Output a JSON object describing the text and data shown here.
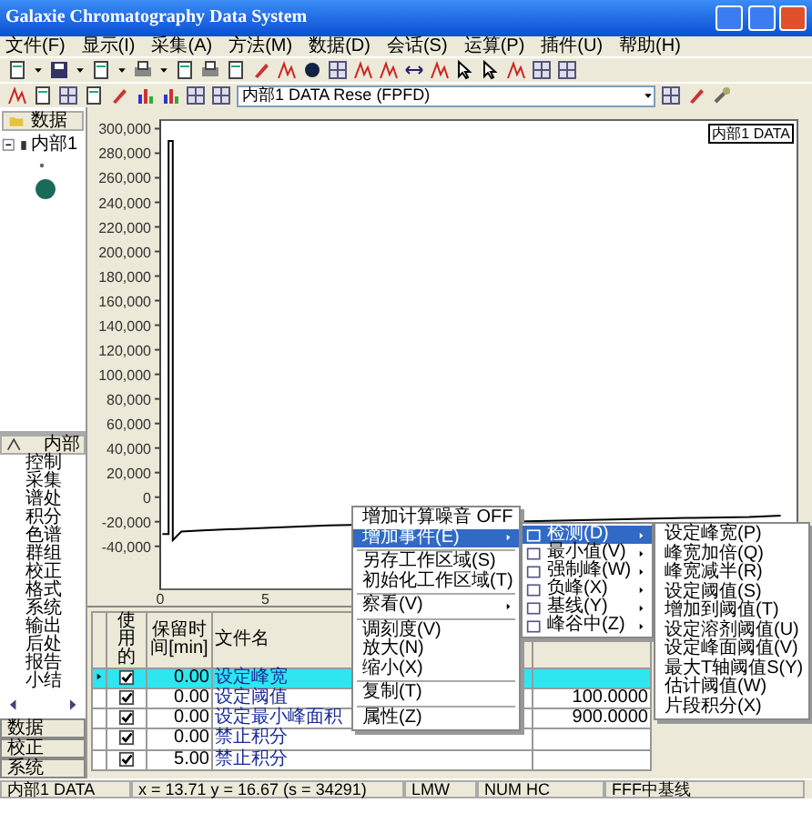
{
  "window": {
    "title": "Galaxie Chromatography Data System"
  },
  "menu_bar": [
    "文件(F)",
    "显示(I)",
    "采集(A)",
    "方法(M)",
    "数据(D)",
    "会话(S)",
    "运算(P)",
    "插件(U)",
    "帮助(H)"
  ],
  "toolbar": {
    "channel_select": "内部1 DATA Rese (FPFD)"
  },
  "tree_panel": {
    "header": "数据",
    "items": [
      {
        "label": "内部1",
        "expanded": true
      }
    ]
  },
  "method_panel": {
    "header": "内部",
    "items": [
      "控制",
      "采集",
      "谱处",
      "积分",
      "色谱",
      "群组",
      "校正",
      "格式",
      "系统",
      "输出",
      "后处",
      "报告",
      "小结"
    ]
  },
  "panel_buttons": [
    "数据",
    "校正",
    "系统"
  ],
  "chart": {
    "tag": "内部1 DATA",
    "chart_data": {
      "type": "line",
      "xlim": [
        0,
        30.3
      ],
      "ylim": [
        -75000,
        307000
      ],
      "xticks": [
        0,
        5
      ],
      "yticks": [
        {
          "value": 300000,
          "label": "300,000"
        },
        {
          "value": 280000,
          "label": "280,000"
        },
        {
          "value": 260000,
          "label": "260,000"
        },
        {
          "value": 240000,
          "label": "240,000"
        },
        {
          "value": 220000,
          "label": "220,000"
        },
        {
          "value": 200000,
          "label": "200,000"
        },
        {
          "value": 180000,
          "label": "180,000"
        },
        {
          "value": 160000,
          "label": "160,000"
        },
        {
          "value": 140000,
          "label": "140,000"
        },
        {
          "value": 120000,
          "label": "120,000"
        },
        {
          "value": 100000,
          "label": "100,000"
        },
        {
          "value": 80000,
          "label": "80,000"
        },
        {
          "value": 60000,
          "label": "60,000"
        },
        {
          "value": 40000,
          "label": "40,000"
        },
        {
          "value": 20000,
          "label": "20,000"
        },
        {
          "value": 0,
          "label": "0"
        },
        {
          "value": -20000,
          "label": "-20,000"
        },
        {
          "value": -40000,
          "label": "-40,000"
        }
      ],
      "x": [
        0.1,
        0.4,
        0.4,
        0.6,
        0.6,
        1,
        2,
        5,
        8,
        25,
        28,
        29.5
      ],
      "series": [
        {
          "color": "#000000",
          "values": [
            -30000,
            -30000,
            290000,
            290000,
            -35000,
            -28000,
            -27000,
            -25000,
            -23000,
            -17000,
            -16000,
            -15000
          ]
        }
      ]
    }
  },
  "event_table": {
    "columns": [
      "使用的",
      "保留时间[min]",
      "文件名"
    ],
    "rows": [
      {
        "selected": true,
        "checked": true,
        "time": "0.00",
        "event": "设定峰宽",
        "column_4": ""
      },
      {
        "selected": false,
        "checked": true,
        "time": "0.00",
        "event": "设定阈值",
        "column_4": "100.0000"
      },
      {
        "selected": false,
        "checked": true,
        "time": "0.00",
        "event": "设定最小峰面积",
        "column_4": "900.0000"
      },
      {
        "selected": false,
        "checked": true,
        "time": "0.00",
        "event": "禁止积分",
        "column_4": ""
      },
      {
        "selected": false,
        "checked": true,
        "time": "5.00",
        "event": "禁止积分",
        "column_4": ""
      }
    ]
  },
  "context_menu": [
    {
      "kind": "item",
      "label": "增加计算噪音 OFF",
      "selected": false,
      "submenu": false
    },
    {
      "kind": "item",
      "label": "增加事件(E)",
      "selected": true,
      "submenu": true
    },
    {
      "kind": "separator"
    },
    {
      "kind": "item",
      "label": "另存工作区域(S)",
      "selected": false,
      "submenu": false
    },
    {
      "kind": "item",
      "label": "初始化工作区域(T)",
      "selected": false,
      "submenu": false
    },
    {
      "kind": "separator"
    },
    {
      "kind": "item",
      "label": "察看(V)",
      "selected": false,
      "submenu": true
    },
    {
      "kind": "separator"
    },
    {
      "kind": "item",
      "label": "调刻度(V)",
      "selected": false,
      "submenu": false
    },
    {
      "kind": "item",
      "label": "放大(N)",
      "selected": false,
      "submenu": false
    },
    {
      "kind": "item",
      "label": "缩小(X)",
      "selected": false,
      "submenu": false
    },
    {
      "kind": "separator"
    },
    {
      "kind": "item",
      "label": "复制(T)",
      "selected": false,
      "submenu": false
    },
    {
      "kind": "separator"
    },
    {
      "kind": "item",
      "label": "属性(Z)",
      "selected": false,
      "submenu": false
    }
  ],
  "event_submenu": [
    {
      "label": "检测(D)",
      "selected": true
    },
    {
      "label": "最小值(V)",
      "selected": false
    },
    {
      "label": "强制峰(W)",
      "selected": false
    },
    {
      "label": "负峰(X)",
      "selected": false
    },
    {
      "label": "基线(Y)",
      "selected": false
    },
    {
      "label": "峰谷中(Z)",
      "selected": false
    }
  ],
  "detect_submenu": [
    "设定峰宽(P)",
    "峰宽加倍(Q)",
    "峰宽减半(R)",
    "设定阈值(S)",
    "增加到阈值(T)",
    "设定溶剂阈值(U)",
    "设定峰面阈值(V)",
    "最大T轴阈值S(Y)",
    "估计阈值(W)",
    "片段积分(X)"
  ],
  "status_bar": [
    "内部1 DATA",
    "x = 13.71 y = 16.67 (s = 34291)",
    "LMW",
    "NUM HC",
    "FFF中基线"
  ]
}
